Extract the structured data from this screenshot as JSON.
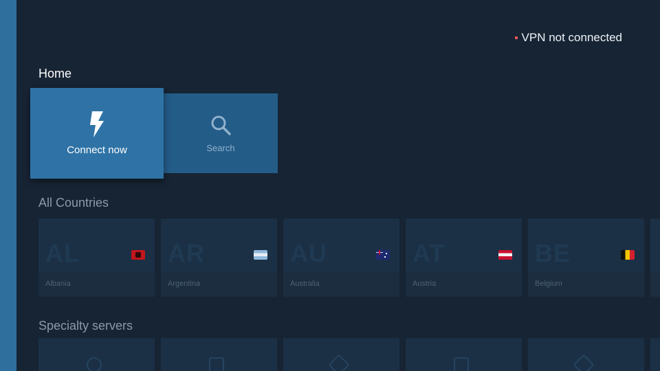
{
  "status": {
    "text": "VPN not connected",
    "dot_color": "#ff5a5a"
  },
  "home": {
    "title": "Home",
    "connect": {
      "label": "Connect now",
      "icon": "lightning-icon"
    },
    "search": {
      "label": "Search",
      "icon": "search-icon"
    }
  },
  "countries": {
    "title": "All Countries",
    "items": [
      {
        "code": "AL",
        "name": "Albania",
        "flag": "albania-flag"
      },
      {
        "code": "AR",
        "name": "Argentina",
        "flag": "argentina-flag"
      },
      {
        "code": "AU",
        "name": "Australia",
        "flag": "australia-flag"
      },
      {
        "code": "AT",
        "name": "Austria",
        "flag": "austria-flag"
      },
      {
        "code": "BE",
        "name": "Belgium",
        "flag": "belgium-flag"
      }
    ]
  },
  "specialty": {
    "title": "Specialty servers"
  },
  "colors": {
    "accent": "#2f73a6",
    "background": "#172434",
    "side_strip": "#2e6f9e"
  }
}
